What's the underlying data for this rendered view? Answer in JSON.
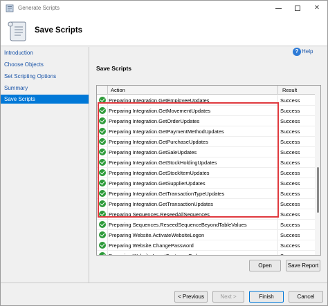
{
  "window": {
    "title": "Generate Scripts"
  },
  "header": {
    "title": "Save Scripts"
  },
  "nav": {
    "items": [
      {
        "label": "Introduction",
        "selected": false
      },
      {
        "label": "Choose Objects",
        "selected": false
      },
      {
        "label": "Set Scripting Options",
        "selected": false
      },
      {
        "label": "Summary",
        "selected": false
      },
      {
        "label": "Save Scripts",
        "selected": true
      }
    ]
  },
  "main": {
    "help_label": "Help",
    "section_title": "Save Scripts"
  },
  "grid": {
    "columns": {
      "action": "Action",
      "result": "Result"
    },
    "rows": [
      {
        "action": "Preparing Integration.GetEmployeeUpdates",
        "result": "Success",
        "status_icon": "success-check-icon"
      },
      {
        "action": "Preparing Integration.GetMovementUpdates",
        "result": "Success",
        "status_icon": "success-check-icon"
      },
      {
        "action": "Preparing Integration.GetOrderUpdates",
        "result": "Success",
        "status_icon": "success-check-icon"
      },
      {
        "action": "Preparing Integration.GetPaymentMethodUpdates",
        "result": "Success",
        "status_icon": "success-check-icon"
      },
      {
        "action": "Preparing Integration.GetPurchaseUpdates",
        "result": "Success",
        "status_icon": "success-check-icon"
      },
      {
        "action": "Preparing Integration.GetSaleUpdates",
        "result": "Success",
        "status_icon": "success-check-icon"
      },
      {
        "action": "Preparing Integration.GetStockHoldingUpdates",
        "result": "Success",
        "status_icon": "success-check-icon"
      },
      {
        "action": "Preparing Integration.GetStockItemUpdates",
        "result": "Success",
        "status_icon": "success-check-icon"
      },
      {
        "action": "Preparing Integration.GetSupplierUpdates",
        "result": "Success",
        "status_icon": "success-check-icon"
      },
      {
        "action": "Preparing Integration.GetTransactionTypeUpdates",
        "result": "Success",
        "status_icon": "success-check-icon"
      },
      {
        "action": "Preparing Integration.GetTransactionUpdates",
        "result": "Success",
        "status_icon": "success-check-icon"
      },
      {
        "action": "Preparing Sequences.ReseedAllSequences",
        "result": "Success",
        "status_icon": "success-check-icon"
      },
      {
        "action": "Preparing Sequences.ReseedSequenceBeyondTableValues",
        "result": "Success",
        "status_icon": "success-check-icon"
      },
      {
        "action": "Preparing Website.ActivateWebsiteLogon",
        "result": "Success",
        "status_icon": "success-check-icon"
      },
      {
        "action": "Preparing Website.ChangePassword",
        "result": "Success",
        "status_icon": "success-check-icon"
      },
      {
        "action": "Preparing Website.InsertCustomerOrders",
        "result": "Success",
        "status_icon": "success-check-icon"
      }
    ]
  },
  "buttons": {
    "open": "Open",
    "save_report": "Save Report",
    "previous": "< Previous",
    "next": "Next >",
    "finish": "Finish",
    "cancel": "Cancel"
  },
  "colors": {
    "selection": "#0078d7",
    "highlight_border": "#e0393e",
    "success": "#2e9b3a",
    "link": "#1a54a8"
  }
}
